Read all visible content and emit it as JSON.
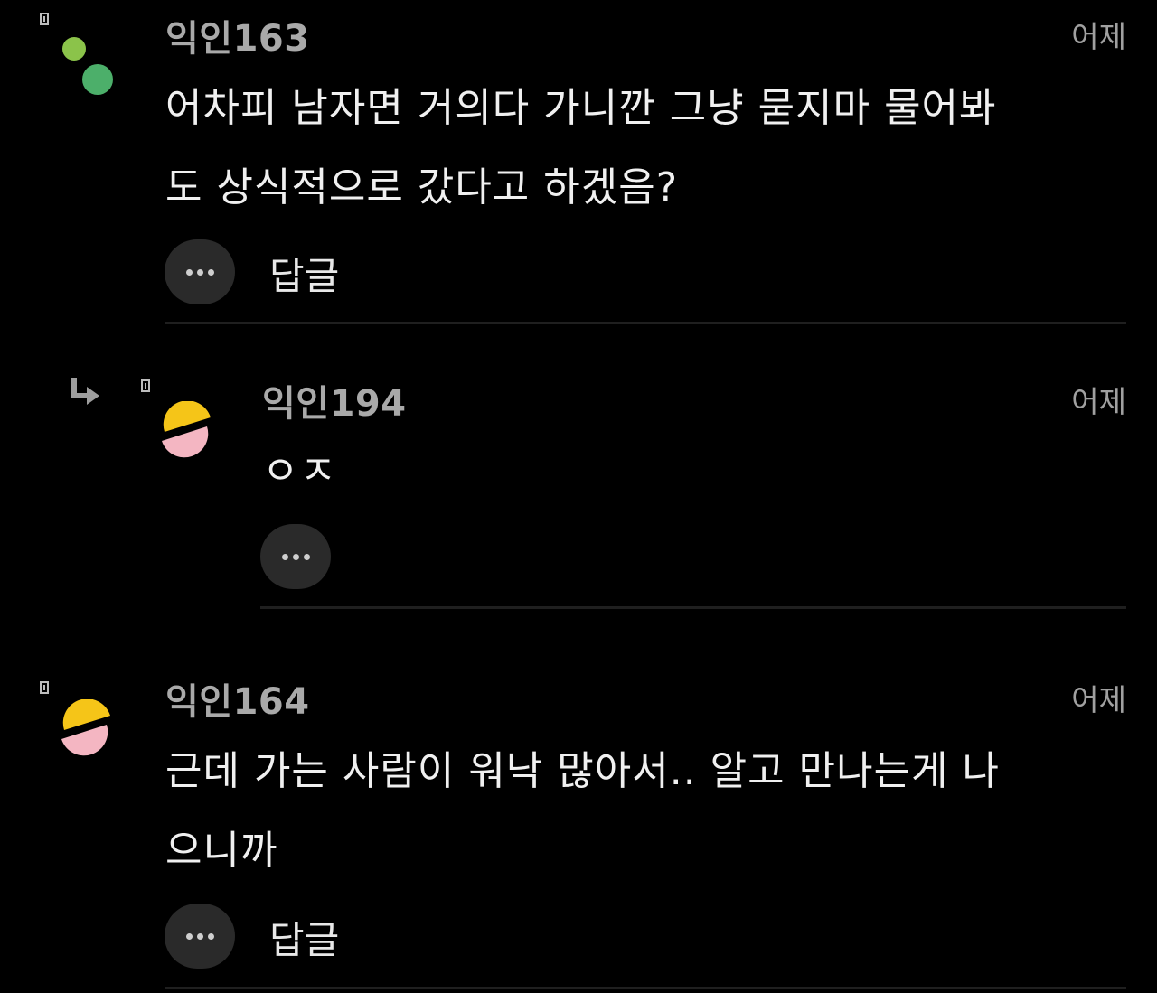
{
  "comments": [
    {
      "nickname": "익인163",
      "time": "어제",
      "body_lines": [
        "어차피 남자면 거의다 가니깐 그냥 묻지마 물어봐",
        "도 상식적으로 갔다고 하겠음?"
      ],
      "reply_label": "답글",
      "avatar": "green-dots"
    },
    {
      "nickname": "익인194",
      "time": "어제",
      "body_lines": [
        "ㅇㅈ"
      ],
      "avatar": "yellow-pink-circle",
      "is_reply": true
    },
    {
      "nickname": "익인164",
      "time": "어제",
      "body_lines": [
        "근데 가는 사람이 워낙 많아서.. 알고 만나는게 나",
        "으니까"
      ],
      "reply_label": "답글",
      "avatar": "yellow-pink-circle"
    }
  ],
  "colors": {
    "background": "#000000",
    "nickname": "#a9a9a9",
    "button_bg": "#2a2a2a",
    "avatar_green_light": "#8bc34a",
    "avatar_green": "#4caf6a",
    "avatar_yellow": "#f5c518",
    "avatar_pink": "#f4b6c2"
  },
  "icons": [
    "marker-icon",
    "reply-arrow-icon",
    "more-dots-icon"
  ]
}
